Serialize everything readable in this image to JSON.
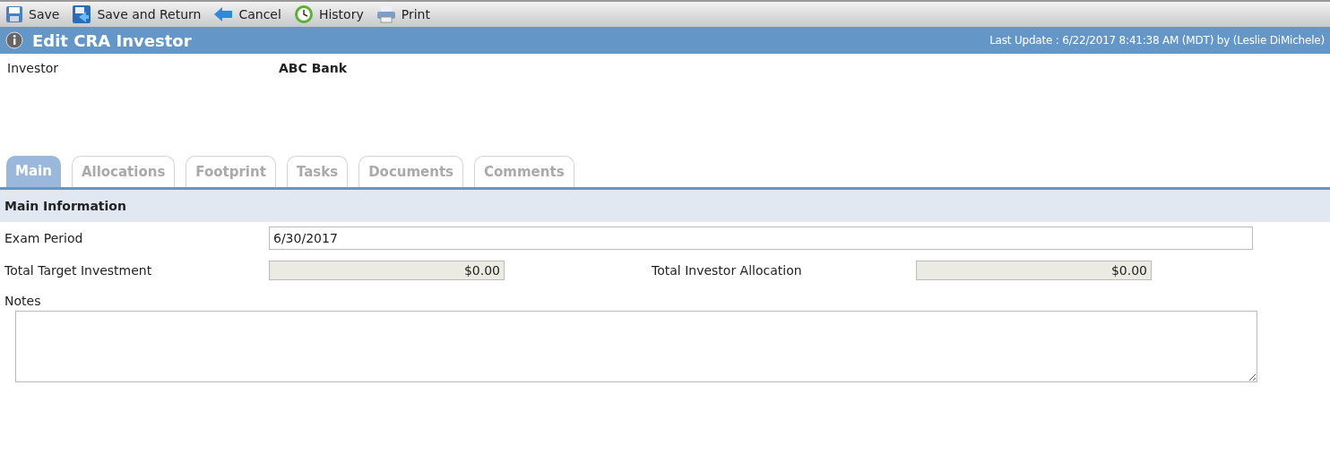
{
  "toolbar": [
    {
      "kind": "save",
      "label": "Save"
    },
    {
      "kind": "save-return",
      "label": "Save and Return"
    },
    {
      "kind": "cancel",
      "label": "Cancel"
    },
    {
      "kind": "history",
      "label": "History"
    },
    {
      "kind": "print",
      "label": "Print"
    }
  ],
  "header": {
    "title": "Edit CRA Investor",
    "last_update": "Last Update : 6/22/2017 8:41:38 AM (MDT) by (Leslie DiMichele)"
  },
  "investor": {
    "label": "Investor",
    "value": "ABC Bank"
  },
  "tabs": [
    {
      "label": "Main",
      "selected": true
    },
    {
      "label": "Allocations",
      "selected": false
    },
    {
      "label": "Footprint",
      "selected": false
    },
    {
      "label": "Tasks",
      "selected": false
    },
    {
      "label": "Documents",
      "selected": false
    },
    {
      "label": "Comments",
      "selected": false
    }
  ],
  "section": {
    "title": "Main Information"
  },
  "exam_period": {
    "label": "Exam Period",
    "value": "6/30/2017"
  },
  "totals": [
    {
      "label": "Total Target Investment",
      "value": "$0.00",
      "disabled": true
    },
    {
      "label": "Total Investor Allocation",
      "value": "$0.00",
      "disabled": true
    }
  ],
  "notes": {
    "label": "Notes"
  }
}
